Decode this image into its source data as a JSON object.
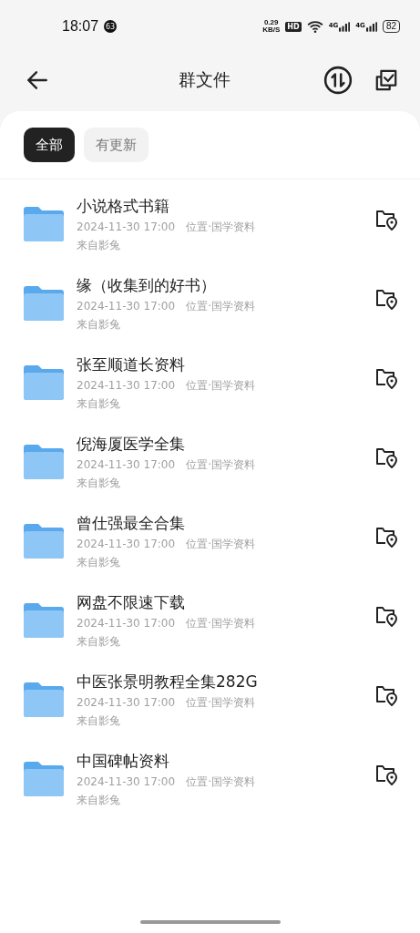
{
  "status_bar": {
    "time": "18:07",
    "notification_count": "63",
    "speed": "0.29",
    "speed_unit": "KB/S",
    "hd": "HD",
    "network_1": "4G",
    "network_2": "4G",
    "battery": "82"
  },
  "header": {
    "title": "群文件"
  },
  "tabs": [
    {
      "label": "全部",
      "selected": true
    },
    {
      "label": "有更新",
      "selected": false
    }
  ],
  "files": [
    {
      "name": "小说格式书籍",
      "time": "2024-11-30 17:00",
      "location": "位置·国学资料",
      "source": "来自影兔"
    },
    {
      "name": "缘（收集到的好书）",
      "time": "2024-11-30 17:00",
      "location": "位置·国学资料",
      "source": "来自影兔"
    },
    {
      "name": "张至顺道长资料",
      "time": "2024-11-30 17:00",
      "location": "位置·国学资料",
      "source": "来自影兔"
    },
    {
      "name": "倪海厦医学全集",
      "time": "2024-11-30 17:00",
      "location": "位置·国学资料",
      "source": "来自影兔"
    },
    {
      "name": "曾仕强最全合集",
      "time": "2024-11-30 17:00",
      "location": "位置·国学资料",
      "source": "来自影兔"
    },
    {
      "name": "网盘不限速下载",
      "time": "2024-11-30 17:00",
      "location": "位置·国学资料",
      "source": "来自影兔"
    },
    {
      "name": "中医张景明教程全集282G",
      "time": "2024-11-30 17:00",
      "location": "位置·国学资料",
      "source": "来自影兔"
    },
    {
      "name": "中国碑帖资料",
      "time": "2024-11-30 17:00",
      "location": "位置·国学资料",
      "source": "来自影兔"
    }
  ]
}
